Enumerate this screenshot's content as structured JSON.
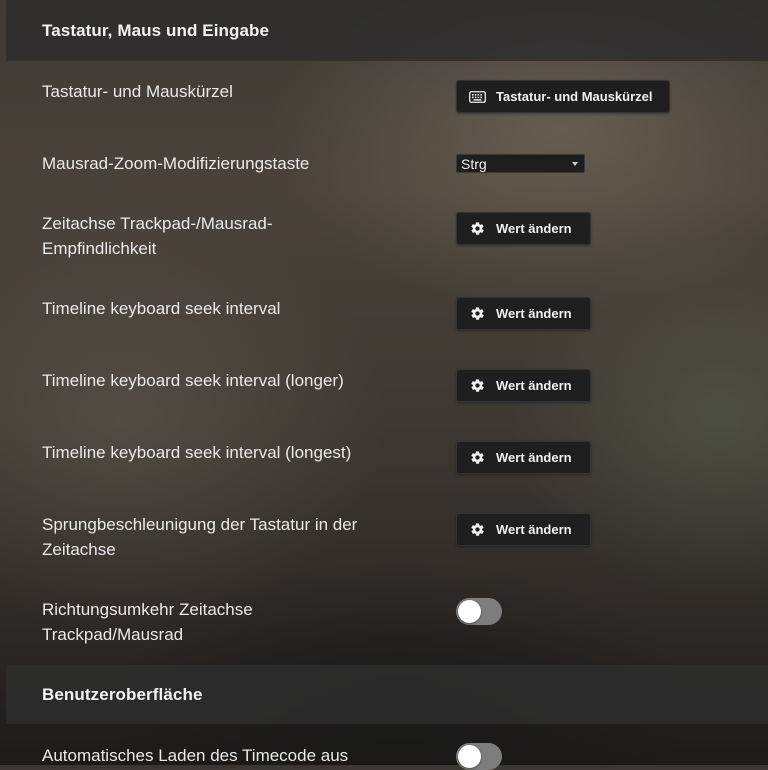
{
  "sections": [
    {
      "title": "Tastatur, Maus und Eingabe"
    },
    {
      "title": "Benutzeroberfläche"
    }
  ],
  "settings": {
    "shortcuts": {
      "label": "Tastatur- und Mauskürzel",
      "button": "Tastatur- und Mauskürzel",
      "icon": "keyboard-icon"
    },
    "zoom_modifier": {
      "label": "Mausrad-Zoom-Modifizierungstaste",
      "value": "Strg"
    },
    "timeline_sensitivity": {
      "label_line1": "Zeitachse Trackpad-/Mausrad-",
      "label_line2": "Empfindlichkeit",
      "button": "Wert ändern"
    },
    "seek_interval": {
      "label": "Timeline keyboard seek interval",
      "button": "Wert ändern"
    },
    "seek_interval_longer": {
      "label": "Timeline keyboard seek interval (longer)",
      "button": "Wert ändern"
    },
    "seek_interval_longest": {
      "label": "Timeline keyboard seek interval (longest)",
      "button": "Wert ändern"
    },
    "seek_acceleration": {
      "label_line1": "Sprungbeschleunigung der Tastatur in der",
      "label_line2": "Zeitachse",
      "button": "Wert ändern"
    },
    "reverse_direction": {
      "label_line1": "Richtungsumkehr Zeitachse",
      "label_line2": "Trackpad/Mausrad",
      "enabled": false
    },
    "auto_timecode": {
      "label": "Automatisches Laden des Timecode aus",
      "enabled": false
    }
  },
  "colors": {
    "header_bg": "#2d2d2d",
    "button_bg": "#1f1f1f",
    "toggle_off": "#7d7d7d"
  }
}
